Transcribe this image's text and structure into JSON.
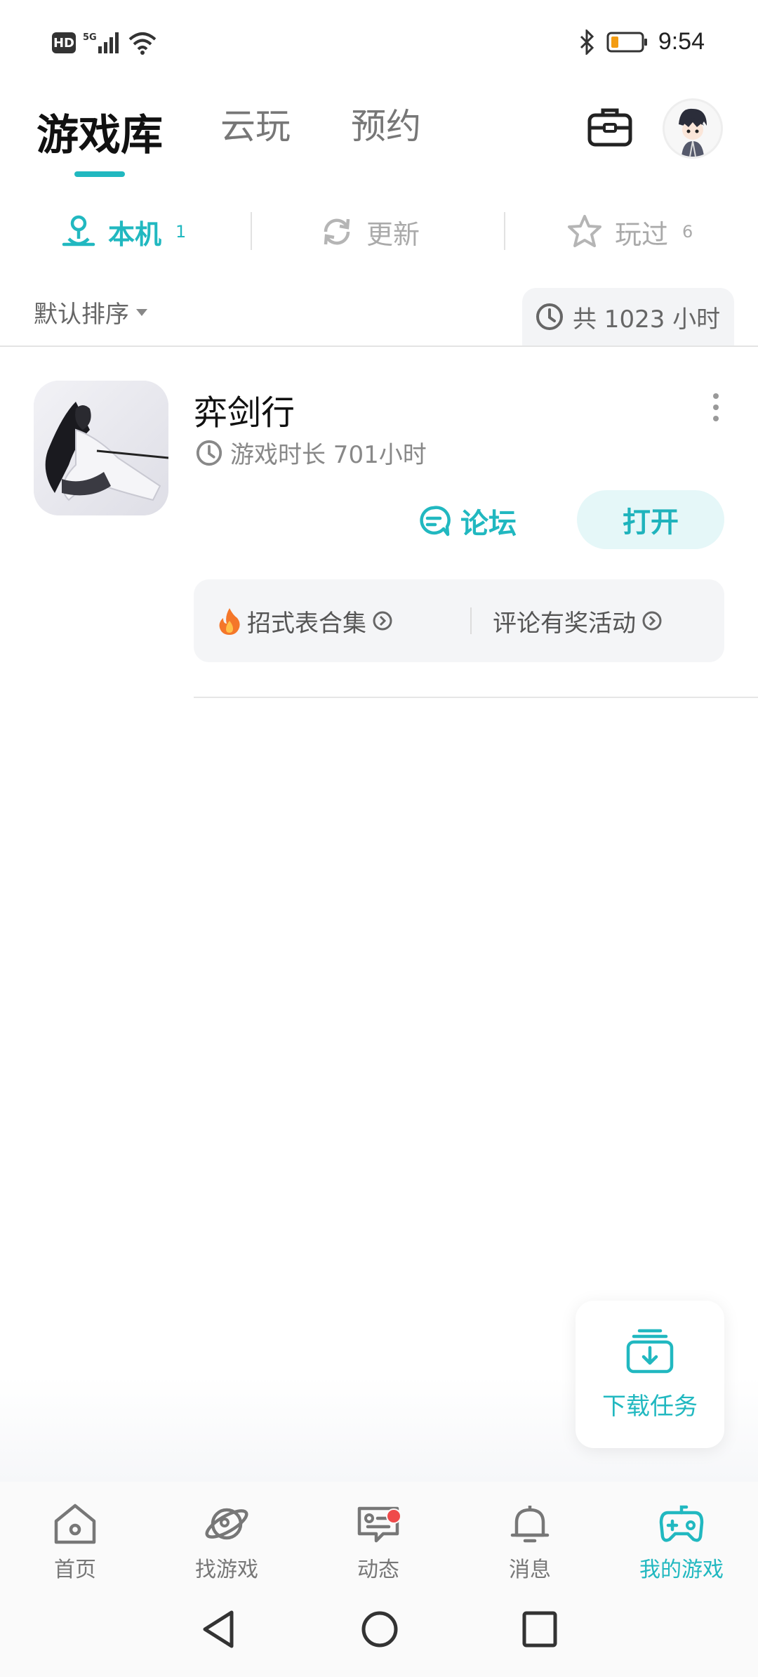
{
  "status_bar": {
    "left_badges": {
      "hd": "HD"
    },
    "time": "9:54",
    "battery_color": "#f39c12"
  },
  "header": {
    "tabs": [
      {
        "label": "游戏库",
        "active": true
      },
      {
        "label": "云玩",
        "active": false
      },
      {
        "label": "预约",
        "active": false
      }
    ],
    "icons": {
      "toolbox": "toolbox-icon",
      "avatar": "avatar"
    }
  },
  "filters": [
    {
      "label": "本机",
      "count": "1",
      "icon": "location-pin-icon",
      "active": true
    },
    {
      "label": "更新",
      "count": "",
      "icon": "refresh-icon",
      "active": false
    },
    {
      "label": "玩过",
      "count": "6",
      "icon": "star-icon",
      "active": false
    }
  ],
  "sort": {
    "label": "默认排序"
  },
  "total": {
    "text": "共 1023 小时"
  },
  "game": {
    "name": "弈剑行",
    "playtime": "游戏时长 701小时",
    "forum_label": "论坛",
    "open_label": "打开",
    "promos": [
      {
        "label": "招式表合集",
        "icon": "fire-icon"
      },
      {
        "label": "评论有奖活动",
        "icon": ""
      }
    ]
  },
  "download": {
    "label": "下载任务"
  },
  "bottom_nav": [
    {
      "label": "首页",
      "icon": "home-icon",
      "active": false
    },
    {
      "label": "找游戏",
      "icon": "planet-icon",
      "active": false
    },
    {
      "label": "动态",
      "icon": "feed-icon",
      "active": false,
      "badge": true
    },
    {
      "label": "消息",
      "icon": "bell-icon",
      "active": false
    },
    {
      "label": "我的游戏",
      "icon": "gamepad-icon",
      "active": true
    }
  ],
  "colors": {
    "accent": "#21b8c0",
    "badge": "#ef4a4a"
  }
}
